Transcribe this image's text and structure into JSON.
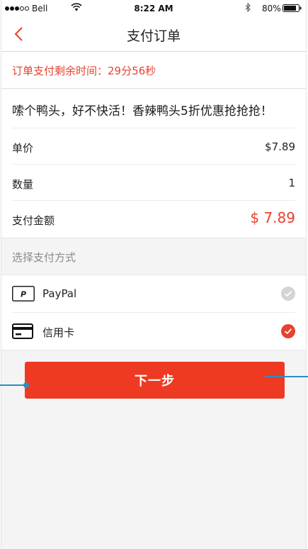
{
  "status_bar": {
    "carrier": "Bell",
    "time": "8:22 AM",
    "battery": "80%",
    "icons": [
      "signal-dots",
      "wifi-icon",
      "bluetooth-icon",
      "battery-icon"
    ]
  },
  "nav": {
    "back_icon": "chevron-left-icon",
    "title": "支付订单"
  },
  "countdown": {
    "text": "订单支付剩余时间：29分56秒"
  },
  "order": {
    "product_title": "嗦个鸭头，好不快活！香辣鸭头5折优惠抢抢抢！",
    "unit_price_label": "单价",
    "unit_price_value": "$7.89",
    "quantity_label": "数量",
    "quantity_value": "1",
    "total_label": "支付金额",
    "total_value": "$ 7.89"
  },
  "payment": {
    "header": "选择支付方式",
    "options": [
      {
        "label": "PayPal",
        "icon": "paypal-icon",
        "selected": false
      },
      {
        "label": "信用卡",
        "icon": "credit-card-icon",
        "selected": true
      }
    ]
  },
  "actions": {
    "next_label": "下一步"
  },
  "colors": {
    "accent": "#ef3a23",
    "accent_text": "#e8412c",
    "callout": "#2a8fc2",
    "background": "#f4f4f4"
  }
}
